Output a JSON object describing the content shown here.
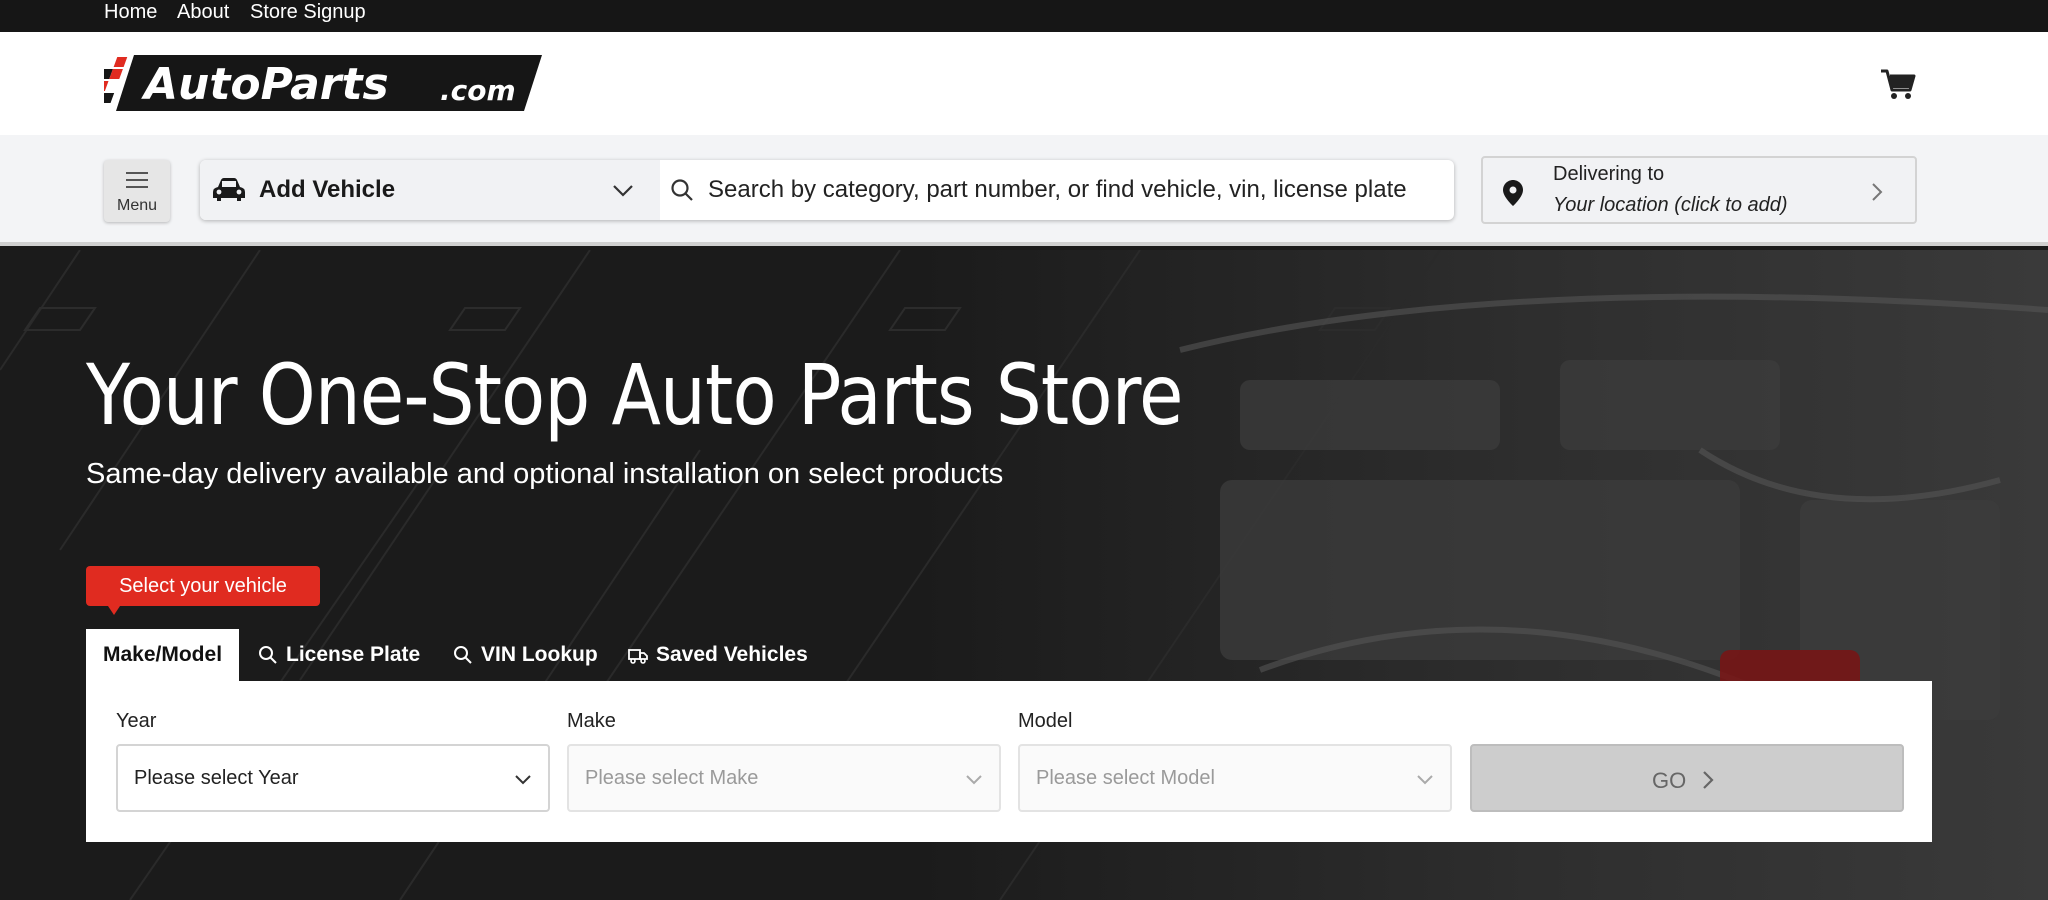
{
  "topnav": {
    "links": [
      "Home",
      "About",
      "Store Signup"
    ]
  },
  "header": {
    "logo_text": "AutoParts",
    "logo_suffix": ".com",
    "cart_icon": "shopping-cart-icon"
  },
  "toolbar": {
    "menu_label": "Menu",
    "vehicle_label": "Add Vehicle",
    "search_placeholder": "Search by category, part number, or find vehicle, vin, license plate",
    "deliver_title": "Delivering to",
    "deliver_location": "Your location (click to add)"
  },
  "hero": {
    "title": "Your One-Stop Auto Parts Store",
    "subtitle": "Same-day delivery available and optional installation on select products",
    "badge": "Select your vehicle",
    "tabs": [
      {
        "label": "Make/Model",
        "icon": ""
      },
      {
        "label": "License Plate",
        "icon": "search-icon"
      },
      {
        "label": "VIN Lookup",
        "icon": "search-icon"
      },
      {
        "label": "Saved Vehicles",
        "icon": "truck-icon"
      }
    ],
    "fields": {
      "year": {
        "label": "Year",
        "placeholder": "Please select Year"
      },
      "make": {
        "label": "Make",
        "placeholder": "Please select Make"
      },
      "model": {
        "label": "Model",
        "placeholder": "Please select Model"
      }
    },
    "go_label": "GO"
  },
  "colors": {
    "accent": "#e02b20",
    "dark": "#161616",
    "toolbar": "#f3f4f6"
  }
}
